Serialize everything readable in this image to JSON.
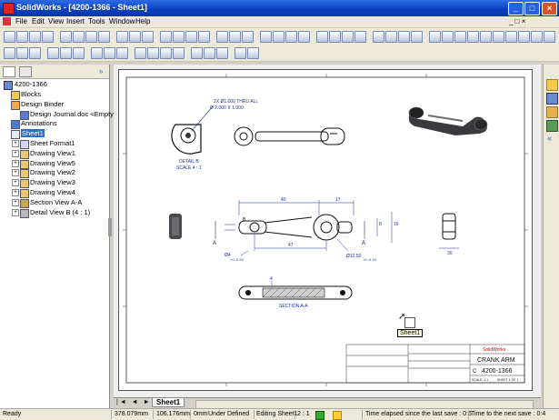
{
  "window": {
    "title": "SolidWorks - [4200-1366 - Sheet1]"
  },
  "menu": [
    "File",
    "Edit",
    "View",
    "Insert",
    "Tools",
    "Window",
    "Help"
  ],
  "tree": {
    "root": "4200-1366",
    "items": [
      {
        "label": "Blocks",
        "icon": "folder-icon"
      },
      {
        "label": "Design Binder",
        "icon": "binder-icon"
      },
      {
        "label": "Design Journal.doc <Empty>",
        "icon": "document-icon"
      },
      {
        "label": "Annotations",
        "icon": "annotations-icon"
      },
      {
        "label": "Sheet1",
        "icon": "sheet-icon",
        "selected": true
      },
      {
        "label": "Sheet Format1",
        "icon": "sheet-format-icon"
      },
      {
        "label": "Drawing View1",
        "icon": "drawing-view-icon"
      },
      {
        "label": "Drawing View5",
        "icon": "drawing-view-icon"
      },
      {
        "label": "Drawing View2",
        "icon": "drawing-view-icon"
      },
      {
        "label": "Drawing View3",
        "icon": "drawing-view-icon"
      },
      {
        "label": "Drawing View4",
        "icon": "drawing-view-icon"
      },
      {
        "label": "Section View A-A",
        "icon": "section-view-icon"
      },
      {
        "label": "Detail View B (4 : 1)",
        "icon": "detail-view-icon"
      }
    ]
  },
  "drawing": {
    "detail_note": "2X Ø1.000 THRU ALL",
    "detail_dims": "Ø 2.000  ⊼ 1.000",
    "detail_label": "DETAIL B",
    "detail_scale": "SCALE 4 : 1",
    "dim_top_left": "40",
    "dim_top_right": "17",
    "dim_bottom_mid": "47",
    "dim_right_a": "8",
    "dim_right_b": "16",
    "dim_phi4": "Ø4",
    "dim_phi4_tol": "+0 -0.20",
    "dim_phi12": "Ø12.50",
    "dim_phi12_tol": "+0 -0.20",
    "dim_side": "30",
    "label_a1": "A",
    "label_a2": "A",
    "section_dim": "4",
    "section_label": "SECTION A-A",
    "label_b": "B"
  },
  "titleblock": {
    "company": "SolidWorks",
    "part_name": "CRANK ARM",
    "size": "C",
    "part_number": "4200-1366",
    "scale": "SCALE: 1:1",
    "sheet": "SHEET 1 OF 1"
  },
  "tooltip": "Sheet1",
  "sheet_tab": "Sheet1",
  "status": {
    "ready": "Ready",
    "x": "378.079mm",
    "y": "106.176mm",
    "z": "0mm",
    "defined": "Under Defined",
    "editing": "Editing Sheet1",
    "scale": "2 : 1",
    "elapsed": "Time elapsed since the last save : 0:6",
    "next_save": "Time to the next save : 0:4"
  },
  "colors": {
    "accent": "#0b3fbf",
    "dim": "#1a2ea0",
    "ink": "#111111",
    "titlebar_close": "#d8542c"
  }
}
